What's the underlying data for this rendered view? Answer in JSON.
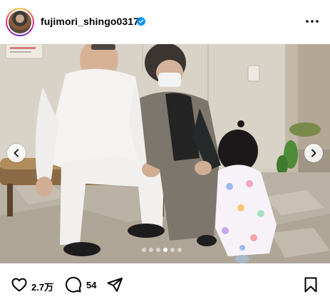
{
  "post": {
    "username": "fujimori_shingo0317",
    "verified": true
  },
  "carousel": {
    "slide_count": 6,
    "active_index": 3
  },
  "actions": {
    "like_count": "2.7万",
    "comment_count": "54"
  },
  "icons": {
    "verified": "verified-badge-icon",
    "more": "more-options-icon",
    "prev": "chevron-left-icon",
    "next": "chevron-right-icon",
    "like": "heart-icon",
    "comment": "comment-bubble-icon",
    "share": "paper-plane-icon",
    "save": "bookmark-icon"
  },
  "colors": {
    "verified_blue": "#0095f6",
    "dot_active": "#ffffff"
  }
}
